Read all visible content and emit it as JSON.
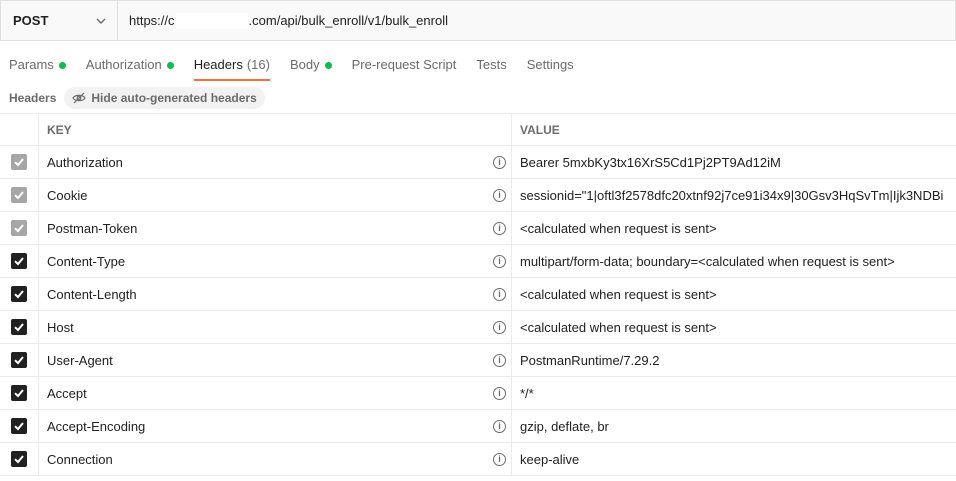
{
  "request": {
    "method": "POST",
    "url_prefix": "https://c",
    "url_suffix": ".com/api/bulk_enroll/v1/bulk_enroll"
  },
  "tabs": [
    {
      "label": "Params",
      "dot": true
    },
    {
      "label": "Authorization",
      "dot": true
    },
    {
      "label": "Headers",
      "count": "(16)",
      "active": true
    },
    {
      "label": "Body",
      "dot": true
    },
    {
      "label": "Pre-request Script"
    },
    {
      "label": "Tests"
    },
    {
      "label": "Settings"
    }
  ],
  "headers_toolbar": {
    "label": "Headers",
    "hide_button": "Hide auto-generated headers"
  },
  "table": {
    "columns": {
      "key": "KEY",
      "value": "VALUE"
    },
    "rows": [
      {
        "key": "Authorization",
        "value": "Bearer 5mxbKy3tx16XrS5Cd1Pj2PT9Ad12iM",
        "checked": "dim"
      },
      {
        "key": "Cookie",
        "value": "sessionid=\"1|oftl3f2578dfc20xtnf92j7ce91i34x9|30Gsv3HqSvTm|Ijk3NDBi",
        "checked": "dim"
      },
      {
        "key": "Postman-Token",
        "value": "<calculated when request is sent>",
        "checked": "dim"
      },
      {
        "key": "Content-Type",
        "value": "multipart/form-data; boundary=<calculated when request is sent>",
        "checked": "on"
      },
      {
        "key": "Content-Length",
        "value": "<calculated when request is sent>",
        "checked": "on"
      },
      {
        "key": "Host",
        "value": "<calculated when request is sent>",
        "checked": "on"
      },
      {
        "key": "User-Agent",
        "value": "PostmanRuntime/7.29.2",
        "checked": "on"
      },
      {
        "key": "Accept",
        "value": "*/*",
        "checked": "on"
      },
      {
        "key": "Accept-Encoding",
        "value": "gzip, deflate, br",
        "checked": "on"
      },
      {
        "key": "Connection",
        "value": "keep-alive",
        "checked": "on"
      }
    ]
  },
  "colors": {
    "accent": "#ff6c37",
    "dot": "#0cbb52"
  }
}
